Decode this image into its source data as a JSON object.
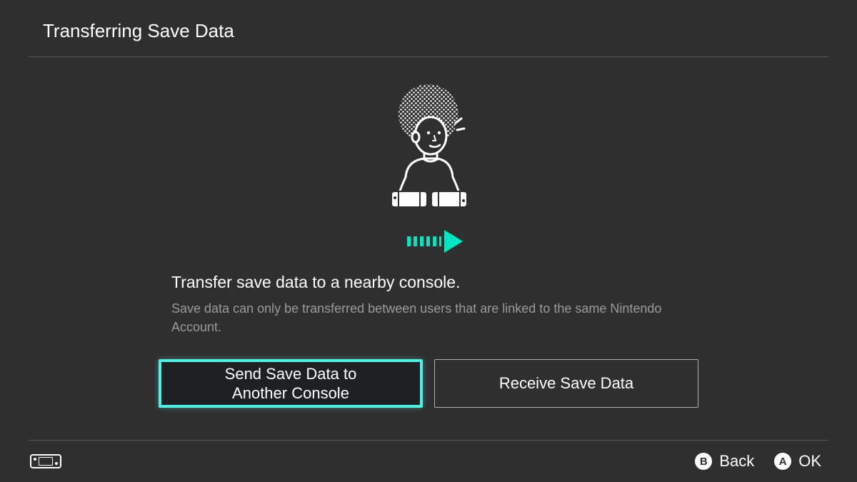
{
  "header": {
    "title": "Transferring Save Data"
  },
  "main": {
    "heading": "Transfer save data to a nearby console.",
    "subtext": "Save data can only be transferred between users that are linked to the same Nintendo Account.",
    "buttons": {
      "send": "Send Save Data to Another Console",
      "receive": "Receive Save Data"
    }
  },
  "footer": {
    "back": {
      "button": "B",
      "label": "Back"
    },
    "ok": {
      "button": "A",
      "label": "OK"
    }
  },
  "colors": {
    "accent": "#00e6c3",
    "background": "#2f2f2f"
  }
}
